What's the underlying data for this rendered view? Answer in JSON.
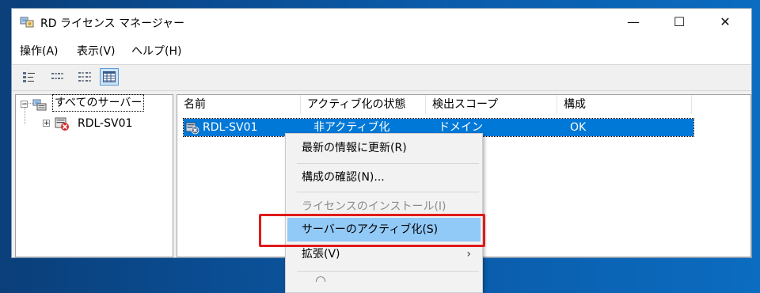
{
  "window": {
    "title": "RD ライセンス マネージャー"
  },
  "titlebar_buttons": {
    "minimize": "—",
    "maximize": "☐",
    "close": "✕"
  },
  "menu": [
    "操作(A)",
    "表示(V)",
    "ヘルプ(H)"
  ],
  "toolbar": {
    "buttons": [
      "large-icons-view-icon",
      "small-icons-view-icon",
      "list-view-icon",
      "details-view-icon"
    ],
    "active": "details-view-icon"
  },
  "tree": {
    "root": {
      "label": "すべてのサーバー",
      "expander": "−"
    },
    "child": {
      "label": "RDL-SV01",
      "expander": "+"
    }
  },
  "list": {
    "columns": [
      "名前",
      "アクティブ化の状態",
      "検出スコープ",
      "構成"
    ],
    "rows": [
      {
        "name": "RDL-SV01",
        "state": "非アクティブ化",
        "scope": "ドメイン",
        "config": "OK"
      }
    ]
  },
  "context_menu": {
    "items": [
      {
        "label": "最新の情報に更新(R)",
        "enabled": true
      },
      {
        "label": "構成の確認(N)...",
        "enabled": true
      },
      {
        "label": "ライセンスのインストール(I)",
        "enabled": false
      },
      {
        "label": "サーバーのアクティブ化(S)",
        "enabled": true,
        "highlighted": true
      },
      {
        "label": "拡張(V)",
        "enabled": true,
        "submenu": "›"
      }
    ]
  },
  "colors": {
    "selection": "#0078d7",
    "menu_highlight": "#91c9f7",
    "callout": "#e01a1a"
  }
}
